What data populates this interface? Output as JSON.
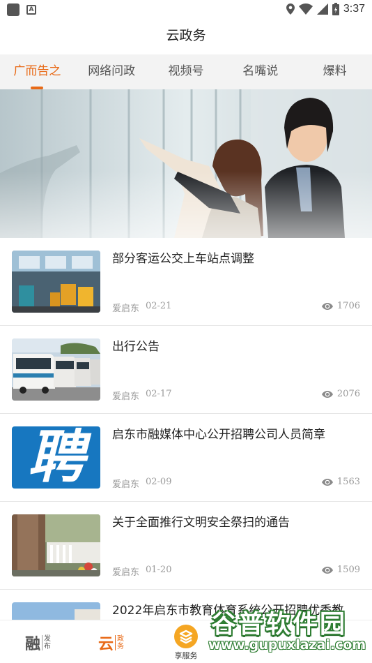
{
  "status_bar": {
    "time": "3:37",
    "icons": [
      "app-square-icon",
      "a-notification-icon",
      "location-icon",
      "wifi-icon",
      "signal-icon",
      "battery-icon"
    ]
  },
  "header": {
    "title": "云政务"
  },
  "tabs": [
    {
      "label": "广而告之",
      "active": true
    },
    {
      "label": "网络问政",
      "active": false
    },
    {
      "label": "视频号",
      "active": false
    },
    {
      "label": "名嘴说",
      "active": false
    },
    {
      "label": "爆料",
      "active": false
    }
  ],
  "news": [
    {
      "title": "部分客运公交上车站点调整",
      "source": "爱启东",
      "date": "02-21",
      "views": "1706"
    },
    {
      "title": "出行公告",
      "source": "爱启东",
      "date": "02-17",
      "views": "2076"
    },
    {
      "title": "启东市融媒体中心公开招聘公司人员简章",
      "source": "爱启东",
      "date": "02-09",
      "views": "1563",
      "thumb_text": "聘"
    },
    {
      "title": "关于全面推行文明安全祭扫的通告",
      "source": "爱启东",
      "date": "01-20",
      "views": "1509"
    },
    {
      "title": "2022年启东市教育体育系统公开招聘优秀教",
      "source": "",
      "date": "",
      "views": ""
    }
  ],
  "bottom_nav": {
    "rong": {
      "big": "融",
      "top": "发",
      "bottom": "布"
    },
    "yun": {
      "big": "云",
      "top": "政",
      "bottom": "务"
    },
    "xiang": {
      "label": "享服务"
    }
  },
  "watermark": {
    "title": "谷普软件园",
    "url": "www.gupuxlazai.com"
  },
  "colors": {
    "accent": "#e86a17",
    "tab_bg": "#f3f3f3",
    "meta": "#9a9a9a"
  }
}
